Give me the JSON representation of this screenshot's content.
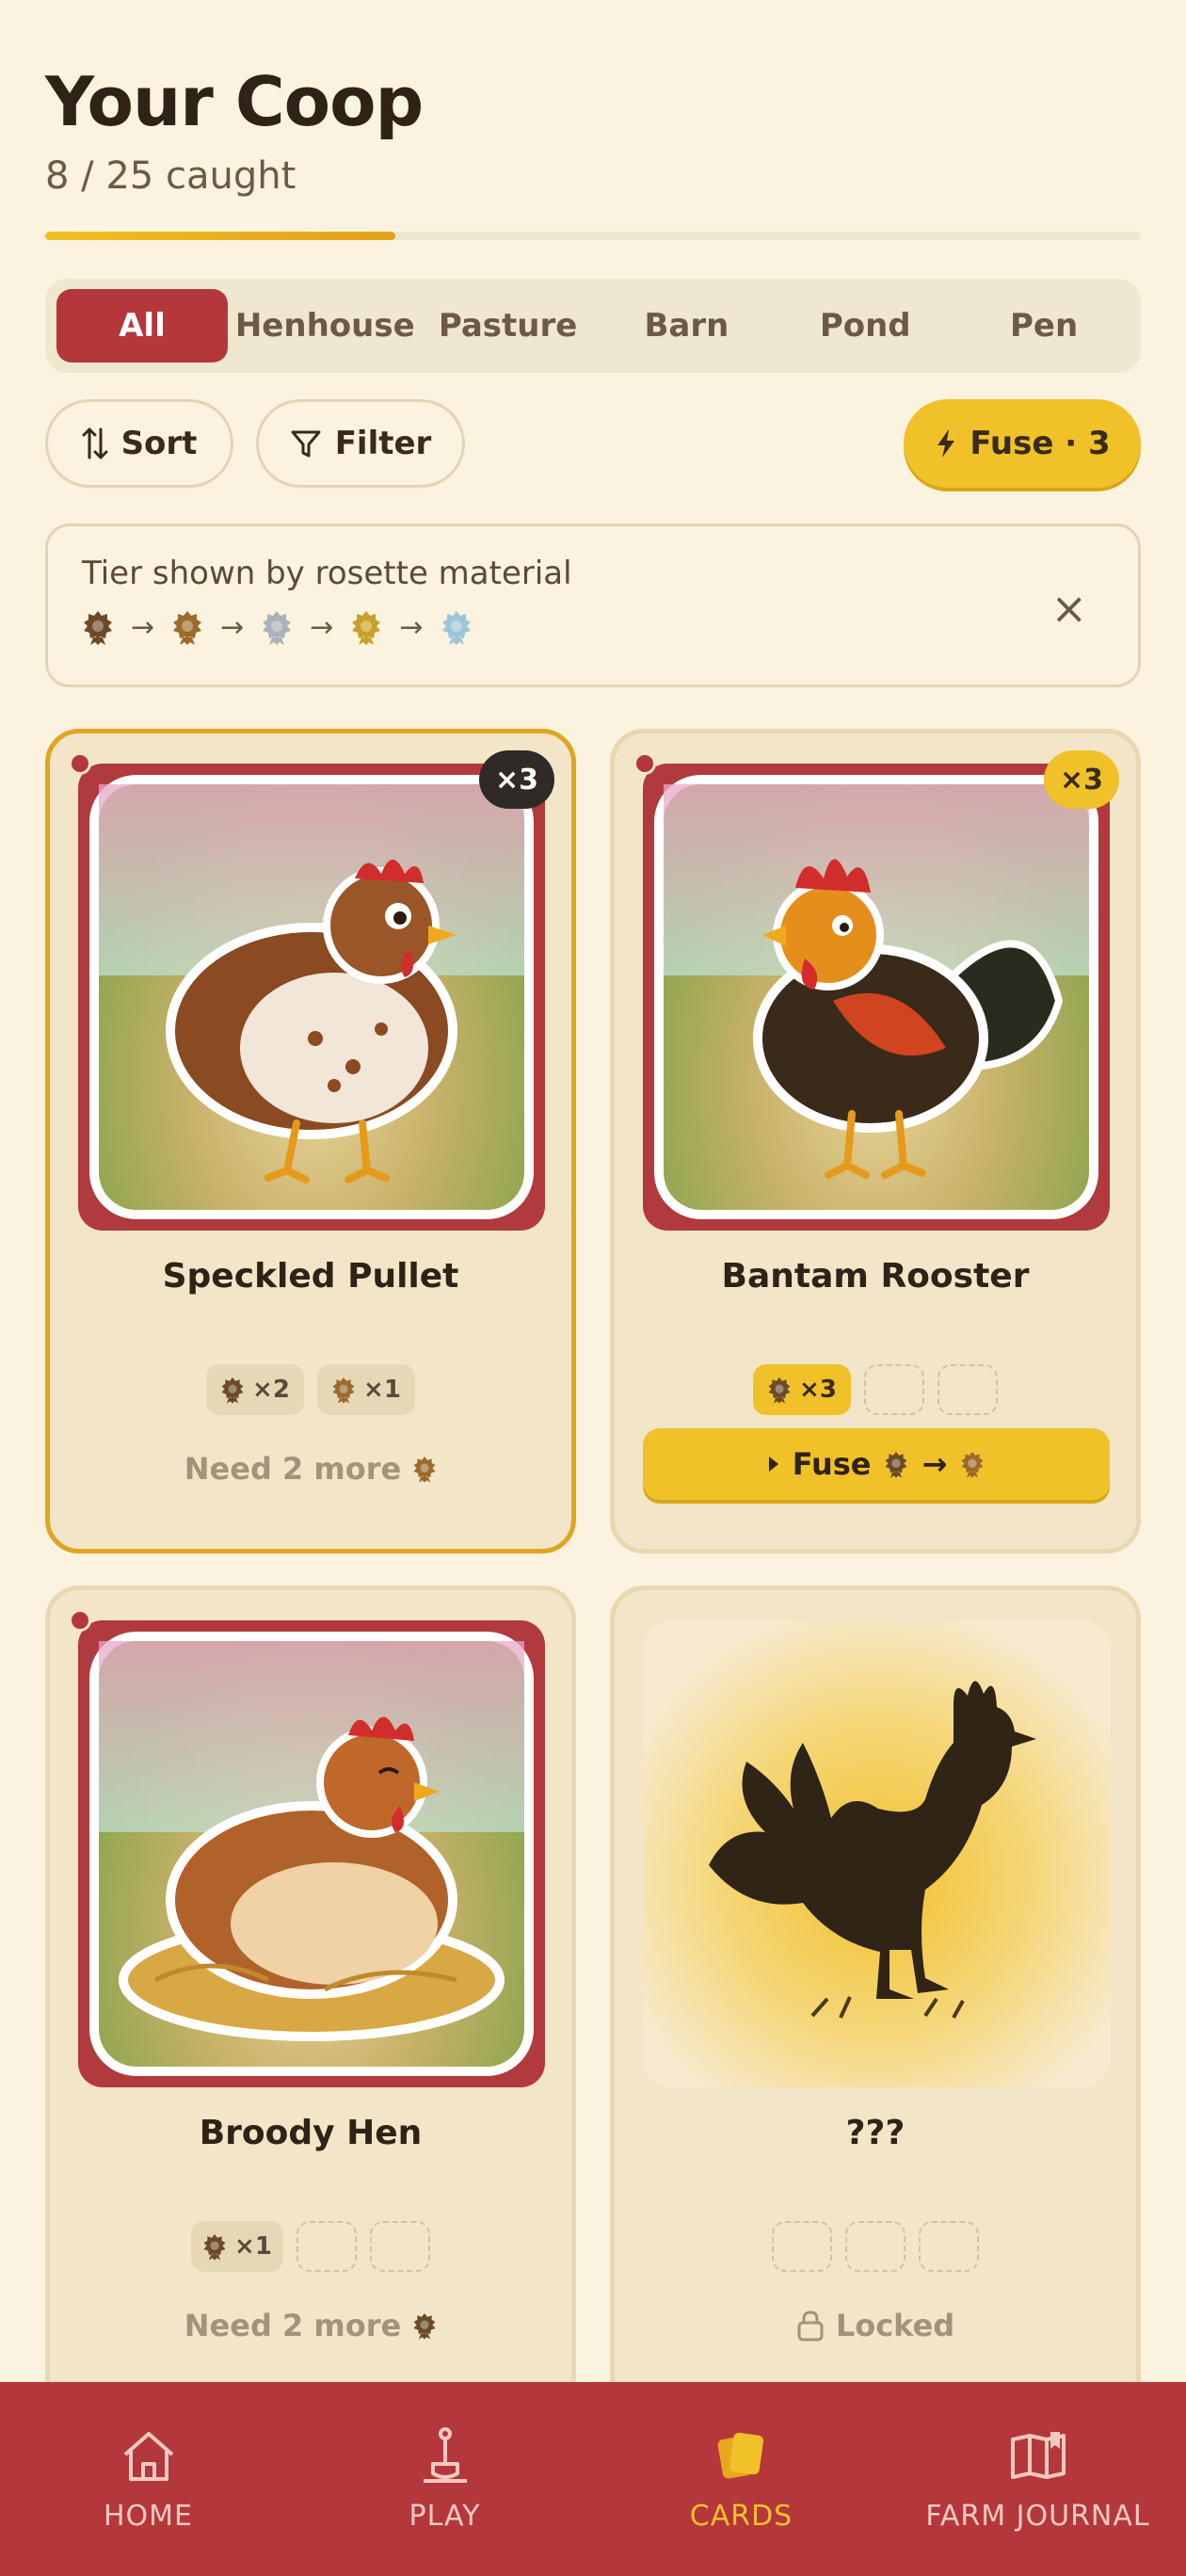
{
  "header": {
    "title": "Your Coop",
    "caught": "8 / 25 caught",
    "progress_fraction": 0.32
  },
  "tabs": [
    {
      "label": "All",
      "active": true
    },
    {
      "label": "Henhouse",
      "active": false
    },
    {
      "label": "Pasture",
      "active": false
    },
    {
      "label": "Barn",
      "active": false
    },
    {
      "label": "Pond",
      "active": false
    },
    {
      "label": "Pen",
      "active": false
    }
  ],
  "toolbar": {
    "sort_label": "Sort",
    "filter_label": "Filter",
    "fuse_label": "Fuse · 3"
  },
  "legend": {
    "text": "Tier shown by rosette material",
    "arrow": "→",
    "close": "×"
  },
  "cards": [
    {
      "name": "Speckled Pullet",
      "count_badge": "×3",
      "chip1": "×2",
      "chip2": "×1",
      "status": "Need 2 more"
    },
    {
      "name": "Bantam Rooster",
      "count_badge": "×3",
      "chip1": "×3",
      "fuse_label": "Fuse",
      "fuse_arrow": "→"
    },
    {
      "name": "Broody Hen",
      "chip1": "×1",
      "status": "Need 2 more"
    },
    {
      "name": "???",
      "status": "Locked"
    }
  ],
  "nav": [
    {
      "label": "HOME",
      "icon": "home-icon"
    },
    {
      "label": "PLAY",
      "icon": "shovel-icon"
    },
    {
      "label": "CARDS",
      "icon": "cards-icon",
      "active": true
    },
    {
      "label": "FARM JOURNAL",
      "icon": "journal-icon"
    }
  ],
  "colors": {
    "accent_red": "#b4373b",
    "accent_gold": "#f0c128",
    "background": "#fbf3df"
  }
}
